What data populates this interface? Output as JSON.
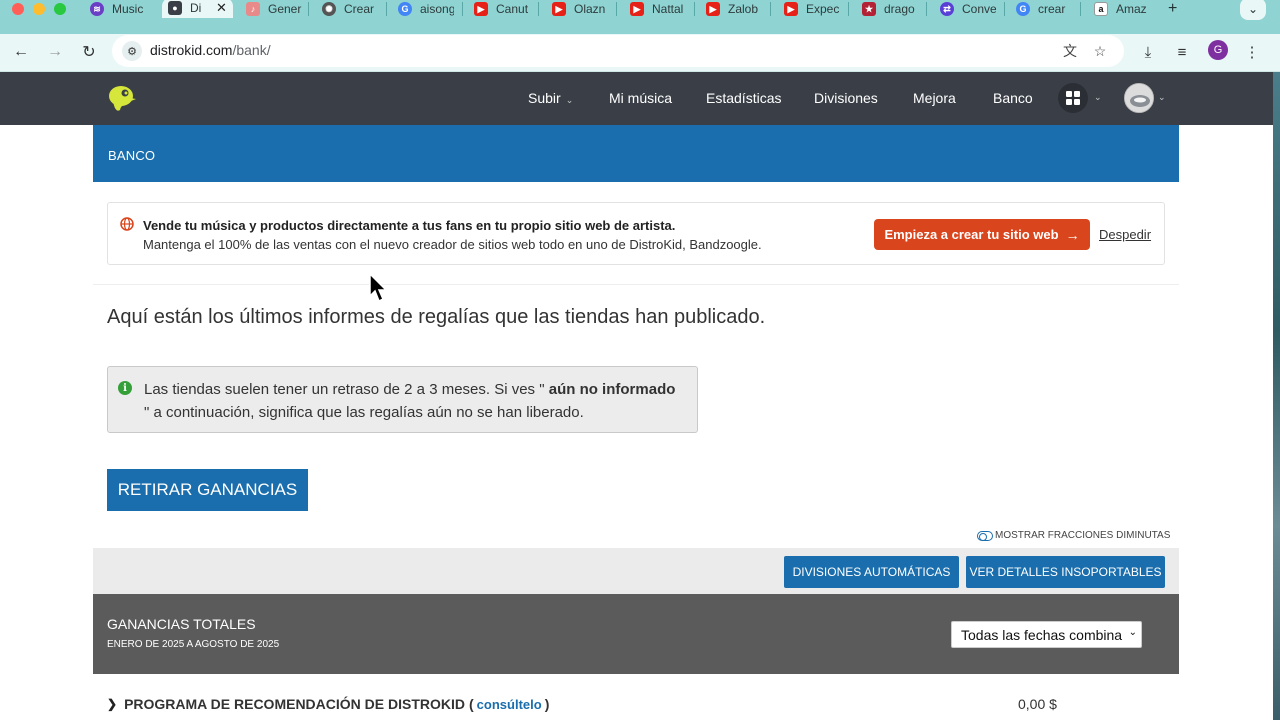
{
  "browser": {
    "tabs": [
      {
        "label": "Music",
        "icon": "spotify-icon",
        "color": "#6a3fc6"
      },
      {
        "label": "Di",
        "icon": "distrokid-icon",
        "color": "#3a3f47",
        "active": true
      },
      {
        "label": "Gener",
        "icon": "music-note-icon",
        "color": "#e98a8a"
      },
      {
        "label": "Crear",
        "icon": "openai-icon",
        "color": "#333333"
      },
      {
        "label": "aisong",
        "icon": "google-icon",
        "color": "#4285f4"
      },
      {
        "label": "Canut",
        "icon": "youtube-icon",
        "color": "#e62117"
      },
      {
        "label": "Olazn",
        "icon": "youtube-icon",
        "color": "#e62117"
      },
      {
        "label": "Nattal",
        "icon": "youtube-icon",
        "color": "#e62117"
      },
      {
        "label": "Zalob",
        "icon": "youtube-icon",
        "color": "#e62117"
      },
      {
        "label": "Expec",
        "icon": "youtube-icon",
        "color": "#e62117"
      },
      {
        "label": "drago",
        "icon": "flag-icon",
        "color": "#b22234"
      },
      {
        "label": "Conve",
        "icon": "convert-icon",
        "color": "#5a3fd6"
      },
      {
        "label": "crear",
        "icon": "google-icon",
        "color": "#4285f4"
      },
      {
        "label": "Amaz",
        "icon": "amazon-icon",
        "color": "#111111"
      }
    ],
    "new_tab": "+",
    "url_host": "distrokid.com",
    "url_path": "/bank/",
    "profile_initial": "G"
  },
  "site_nav": {
    "items": [
      "Subir",
      "Mi música",
      "Estadísticas",
      "Divisiones",
      "Mejora",
      "Banco"
    ]
  },
  "bank": {
    "header": "BANCO"
  },
  "promo": {
    "title": "Vende tu música y productos directamente a tus fans en tu propio sitio web de artista.",
    "text": "Mantenga el 100% de las ventas con el nuevo creador de sitios web todo en uno de DistroKid, Bandzoogle.",
    "cta": "Empieza a crear tu sitio web",
    "dismiss": "Despedir"
  },
  "intro": "Aquí están los últimos informes de regalías que las tiendas han publicado.",
  "info": {
    "before": "Las tiendas suelen tener un retraso de 2 a 3 meses. Si ves \" ",
    "bold": "aún no informado",
    "after": " \" a continuación, significa que las regalías aún no se han liberado."
  },
  "withdraw_label": "RETIRAR GANANCIAS",
  "toggle_label": "MOSTRAR FRACCIONES DIMINUTAS",
  "actions": {
    "auto_splits": "DIVISIONES AUTOMÁTICAS",
    "details": "VER DETALLES INSOPORTABLES"
  },
  "totals": {
    "title": "GANANCIAS TOTALES",
    "range": "ENERO DE 2025 A AGOSTO DE 2025",
    "date_filter": "Todas las fechas combina"
  },
  "referral": {
    "label": "PROGRAMA DE RECOMENDACIÓN DE DISTROKID",
    "open_paren": "(",
    "link": "consúltelo",
    "close_paren": ")",
    "amount": "0,00 $"
  },
  "colors": {
    "brand_blue": "#1a6ead",
    "promo_orange": "#d9451c",
    "nav_dark": "#3a3f47",
    "info_green": "#35a039"
  }
}
